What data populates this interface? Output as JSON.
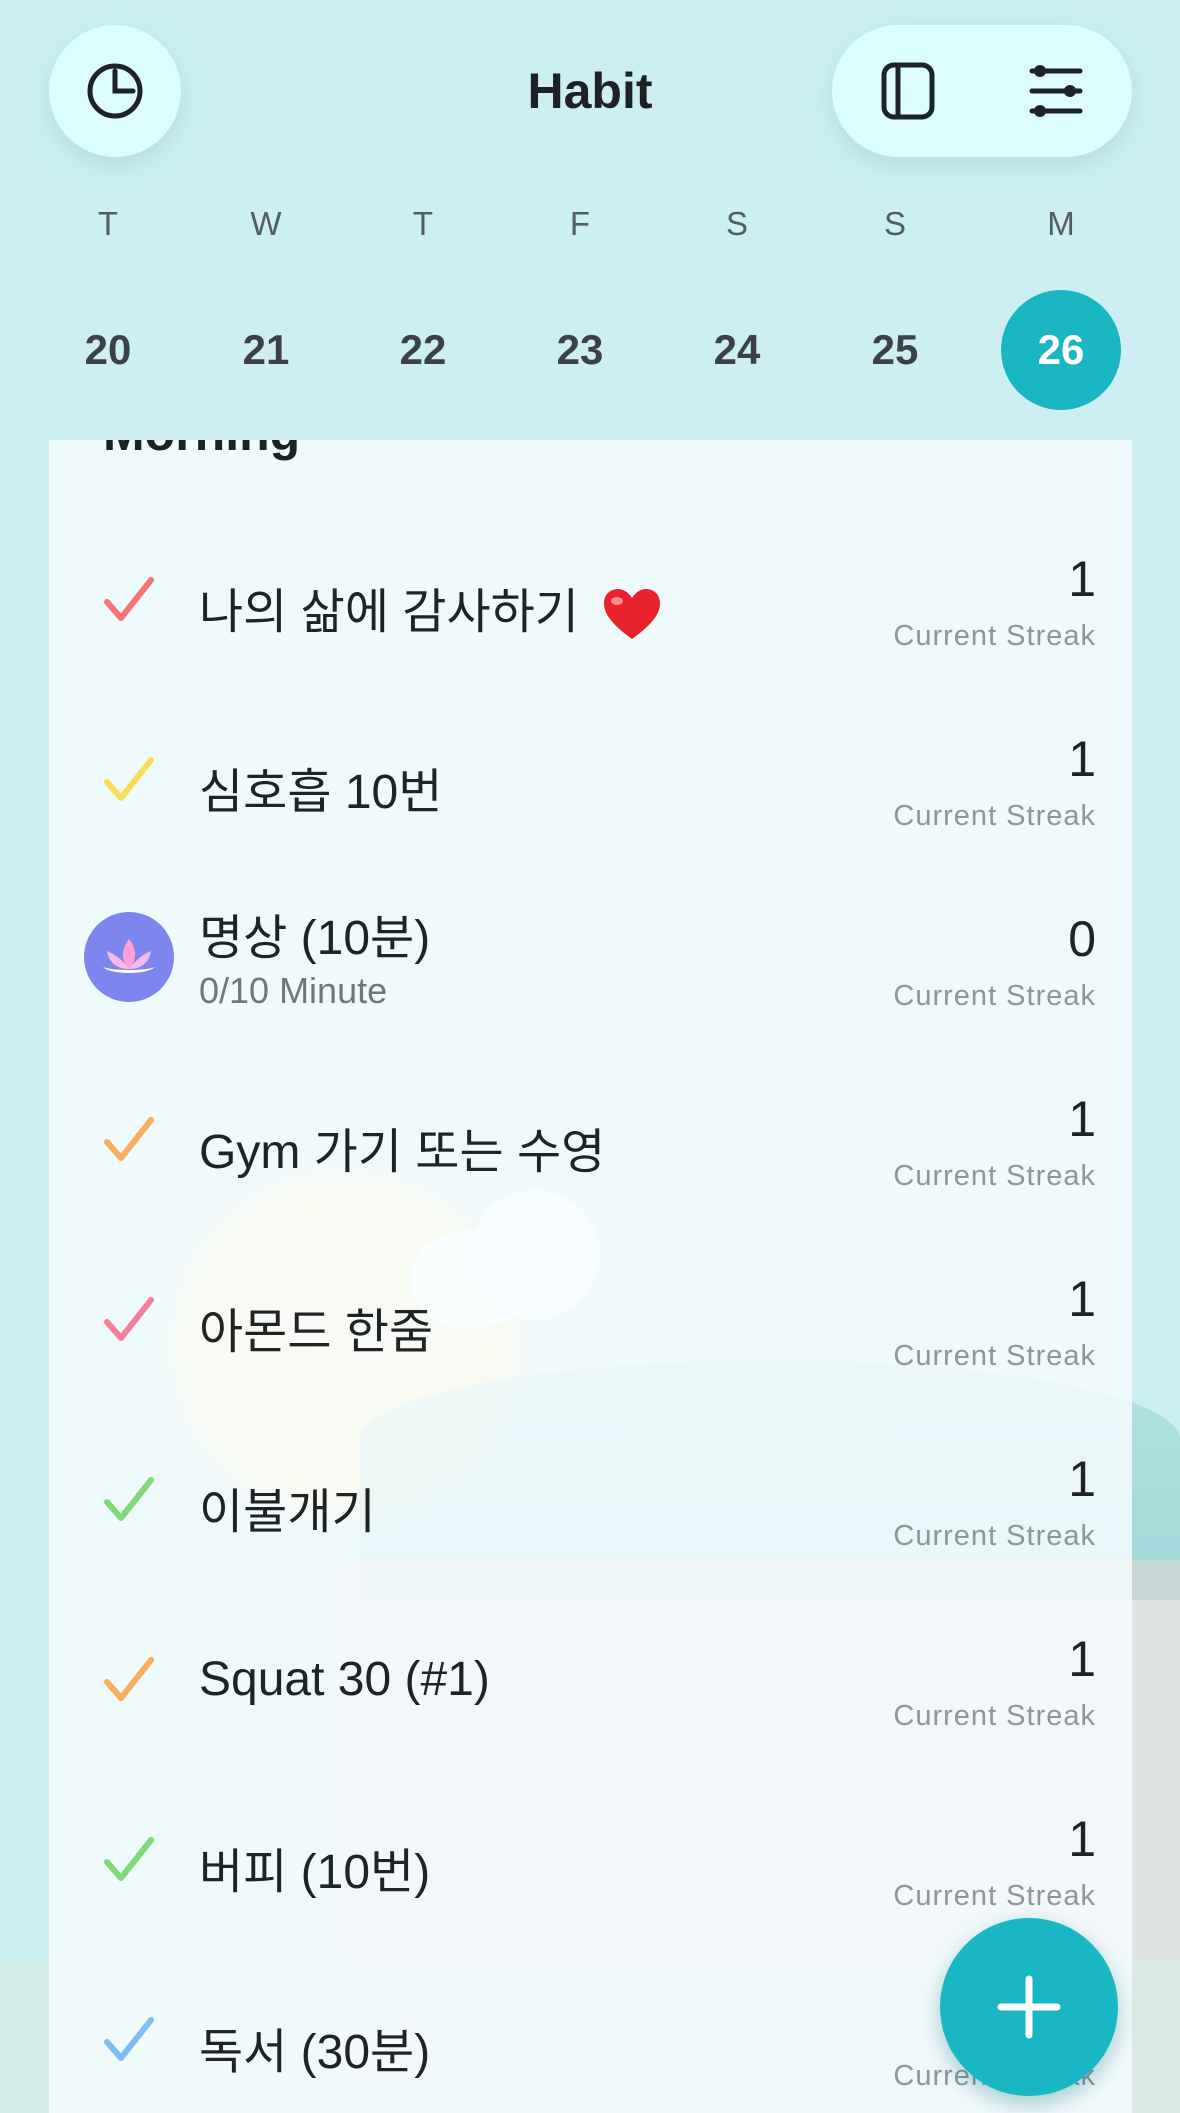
{
  "header": {
    "title": "Habit"
  },
  "calendar": {
    "weekdays": [
      "T",
      "W",
      "T",
      "F",
      "S",
      "S",
      "M"
    ],
    "days": [
      "20",
      "21",
      "22",
      "23",
      "24",
      "25",
      "26"
    ],
    "selected_day": "26",
    "accent_color": "#19b6c4"
  },
  "list": {
    "section_title": "Morning",
    "streak_label": "Current Streak",
    "habits": [
      {
        "label": "나의 삶에 감사하기",
        "emoji": "heart",
        "streak": "1",
        "check_color": "#f77474",
        "streak_label": "Current Streak"
      },
      {
        "label": "심호흡 10번",
        "streak": "1",
        "check_color": "#f8dc5a",
        "streak_label": "Current Streak"
      },
      {
        "label": "명상 (10분)",
        "sub": "0/10 Minute",
        "icon": "lotus-icon",
        "streak": "0",
        "streak_label": "Current Streak"
      },
      {
        "label": "Gym 가기 또는 수영",
        "streak": "1",
        "check_color": "#f8ad5c",
        "streak_label": "Current Streak"
      },
      {
        "label": "아몬드 한줌",
        "streak": "1",
        "check_color": "#f57f9a",
        "streak_label": "Current Streak"
      },
      {
        "label": "이불개기",
        "streak": "1",
        "check_color": "#82d97a",
        "streak_label": "Current Streak"
      },
      {
        "label": "Squat 30 (#1)",
        "streak": "1",
        "check_color": "#f8ad5c",
        "streak_label": "Current Streak"
      },
      {
        "label": "버피 (10번)",
        "streak": "1",
        "check_color": "#82d97a",
        "streak_label": "Current Streak"
      },
      {
        "label": "독서 (30분)",
        "streak": "",
        "check_color": "#7fbef2",
        "streak_label": "Current Streak"
      }
    ]
  },
  "icons": {
    "stats": "pie-chart-icon",
    "view": "card-view-icon",
    "filter": "sliders-icon",
    "add": "plus-icon"
  }
}
